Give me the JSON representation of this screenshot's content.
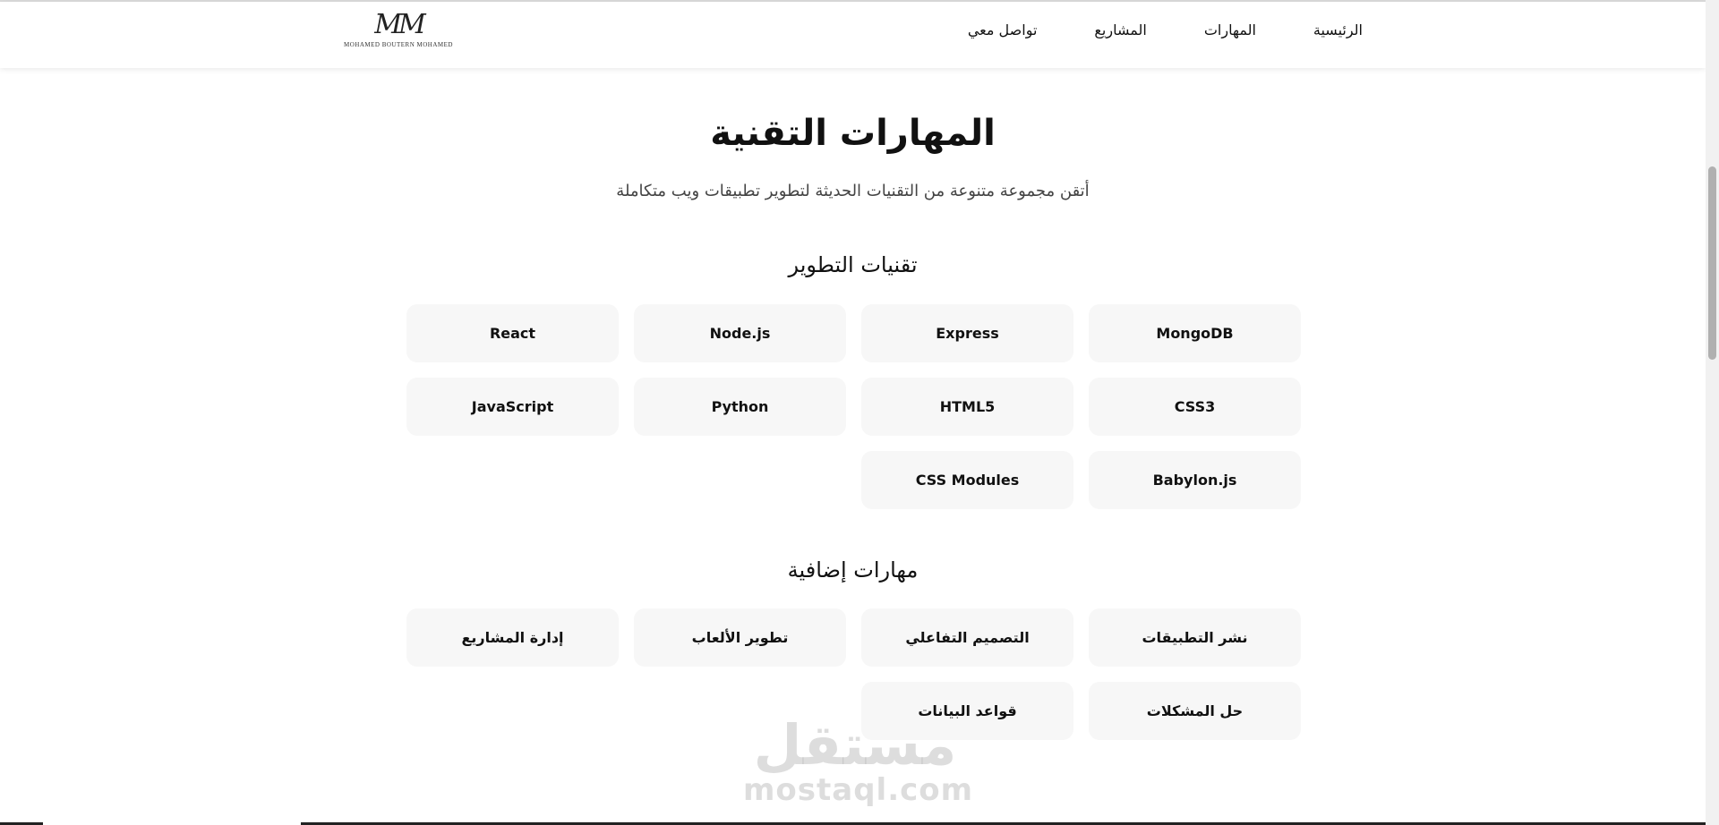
{
  "header": {
    "logo_mark": "MM",
    "logo_subtitle": "MOHAMED BOUTERN MOHAMED",
    "nav": [
      "تواصل معي",
      "المشاريع",
      "المهارات",
      "الرئيسية"
    ]
  },
  "hero": {
    "title": "المهارات التقنية",
    "subtitle": "أتقن مجموعة متنوعة من التقنيات الحديثة لتطوير تطبيقات ويب متكاملة"
  },
  "dev_section": {
    "title": "تقنيات التطوير",
    "skills": [
      "MongoDB",
      "Express",
      "Node.js",
      "React",
      "CSS3",
      "HTML5",
      "Python",
      "JavaScript",
      "Babylon.js",
      "CSS Modules"
    ]
  },
  "extra_section": {
    "title": "مهارات إضافية",
    "skills": [
      "نشر التطبيقات",
      "التصميم التفاعلي",
      "تطوير الألعاب",
      "إدارة المشاريع",
      "حل المشكلات",
      "قواعد البيانات"
    ]
  },
  "watermark": {
    "arabic": "مستقل",
    "latin": "mostaql.com"
  },
  "colors": {
    "card_bg": "#f7f7f7",
    "text": "#111111",
    "subtitle": "#444444"
  }
}
